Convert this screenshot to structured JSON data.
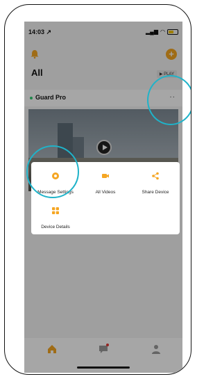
{
  "status_bar": {
    "time": "14:03 ↗"
  },
  "header": {
    "title": "All",
    "play_label": "▶ PLAY"
  },
  "device": {
    "name": "Guard Pro",
    "more_label": "··"
  },
  "actions": [
    {
      "label": "Message Settings",
      "icon": "gear-icon"
    },
    {
      "label": "All Videos",
      "icon": "video-icon"
    },
    {
      "label": "Share Device",
      "icon": "share-icon"
    },
    {
      "label": "Device Details",
      "icon": "grid-icon"
    }
  ],
  "accent_color": "#f5a623",
  "highlight_color": "#1fb3c9"
}
